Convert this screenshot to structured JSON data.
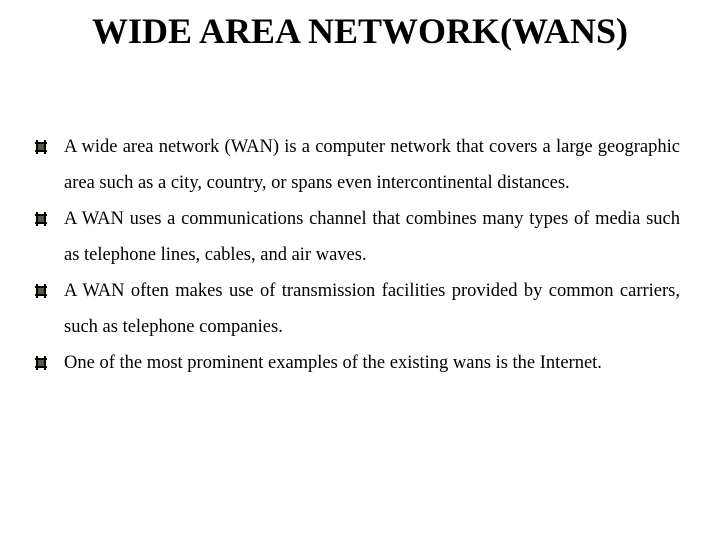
{
  "slide": {
    "title": "WIDE AREA NETWORK(WANS)",
    "bullet_icon": "square-bullet-icon",
    "bullet_color": "#5a5a4a",
    "bullets": [
      "A wide area network (WAN) is a computer network that covers a large geographic area such as a city, country, or spans even intercontinental distances.",
      "A WAN uses a communications channel that combines many types of media such as telephone lines, cables, and air waves.",
      "A WAN often makes use of transmission facilities provided by common carriers, such as telephone companies.",
      "One of the most prominent examples of the existing wans is the Internet."
    ]
  }
}
